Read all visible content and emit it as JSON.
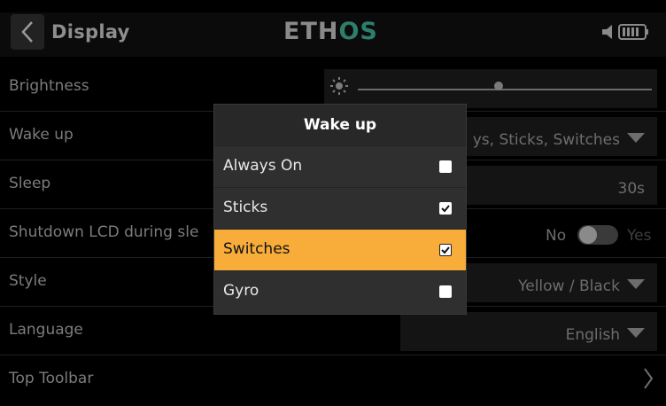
{
  "header": {
    "back_icon": "chevron-left-icon",
    "title": "Display",
    "logo_prefix": "ETH",
    "logo_suffix": "OS",
    "logo_accent": "#2d7e6a",
    "status_icons": [
      "speaker-icon",
      "battery-icon"
    ]
  },
  "settings": {
    "brightness": {
      "label": "Brightness",
      "level": 0.48
    },
    "wake_up": {
      "label": "Wake up",
      "value": "ys, Sticks, Switches"
    },
    "sleep": {
      "label": "Sleep",
      "value": "30s"
    },
    "shutdown_lcd": {
      "label": "Shutdown LCD during sle",
      "off_label": "No",
      "on_label": "Yes",
      "on": false
    },
    "style": {
      "label": "Style",
      "value": "Yellow / Black"
    },
    "language": {
      "label": "Language",
      "value": "English"
    },
    "top_toolbar": {
      "label": "Top Toolbar"
    }
  },
  "popup": {
    "title": "Wake up",
    "options": [
      {
        "label": "Always On",
        "checked": false
      },
      {
        "label": "Sticks",
        "checked": true
      },
      {
        "label": "Switches",
        "checked": true,
        "highlighted": true
      },
      {
        "label": "Gyro",
        "checked": false
      }
    ],
    "highlight_color": "#f8ad3b"
  }
}
